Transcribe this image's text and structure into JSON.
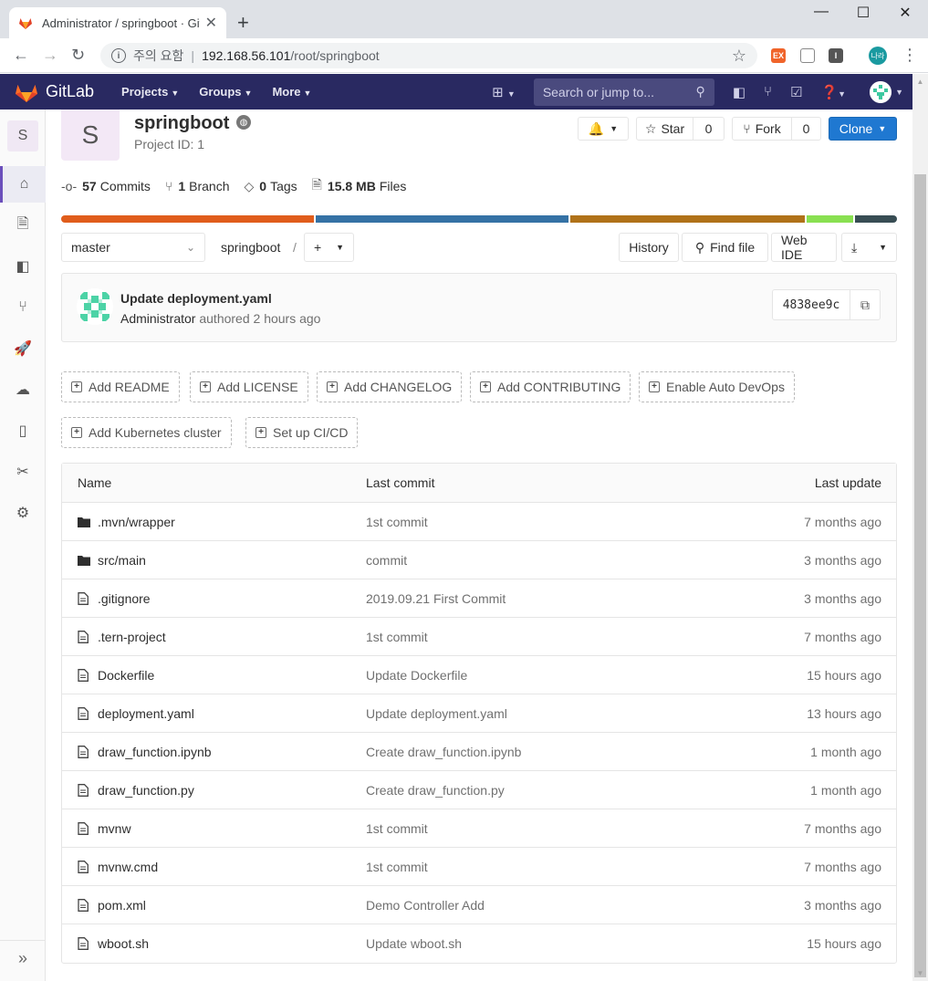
{
  "browser": {
    "tab_title": "Administrator / springboot · GitLab",
    "address_warning": "주의 요함",
    "address_host": "192.168.56.101",
    "address_path": "/root/springboot",
    "profile_label": "나라"
  },
  "nav": {
    "brand": "GitLab",
    "menu": [
      "Projects",
      "Groups",
      "More"
    ],
    "search_placeholder": "Search or jump to..."
  },
  "sidebar": {
    "project_letter": "S"
  },
  "project": {
    "avatar_letter": "S",
    "name": "springboot",
    "id_label": "Project ID: 1",
    "star_label": "Star",
    "star_count": "0",
    "fork_label": "Fork",
    "fork_count": "0",
    "clone_label": "Clone"
  },
  "stats": {
    "commits_count": "57",
    "commits_label": "Commits",
    "branches_count": "1",
    "branches_label": "Branch",
    "tags_count": "0",
    "tags_label": "Tags",
    "files_size": "15.8 MB",
    "files_label": "Files"
  },
  "language_bar": [
    {
      "color": "#e05d1c",
      "share": 30.5
    },
    {
      "color": "#3572a5",
      "share": 30.5
    },
    {
      "color": "#b07219",
      "share": 28.3
    },
    {
      "color": "#89e051",
      "share": 5.6
    },
    {
      "color": "#384d54",
      "share": 5.1
    }
  ],
  "toolbar": {
    "branch": "master",
    "breadcrumb": "springboot",
    "breadcrumb_sep": "/",
    "history": "History",
    "find_file": "Find file",
    "web_ide": "Web IDE"
  },
  "last_commit": {
    "title": "Update deployment.yaml",
    "author": "Administrator",
    "authored": "authored 2 hours ago",
    "sha": "4838ee9c"
  },
  "quick_actions": [
    "Add README",
    "Add LICENSE",
    "Add CHANGELOG",
    "Add CONTRIBUTING",
    "Enable Auto DevOps",
    "Add Kubernetes cluster",
    "Set up CI/CD"
  ],
  "tree": {
    "headers": {
      "name": "Name",
      "commit": "Last commit",
      "update": "Last update"
    },
    "rows": [
      {
        "type": "folder",
        "name": ".mvn/wrapper",
        "commit": "1st commit",
        "date": "7 months ago"
      },
      {
        "type": "folder",
        "name": "src/main",
        "commit": "commit",
        "date": "3 months ago"
      },
      {
        "type": "file",
        "name": ".gitignore",
        "commit": "2019.09.21 First Commit",
        "date": "3 months ago"
      },
      {
        "type": "file",
        "name": ".tern-project",
        "commit": "1st commit",
        "date": "7 months ago"
      },
      {
        "type": "file",
        "name": "Dockerfile",
        "commit": "Update Dockerfile",
        "date": "15 hours ago"
      },
      {
        "type": "file",
        "name": "deployment.yaml",
        "commit": "Update deployment.yaml",
        "date": "13 hours ago"
      },
      {
        "type": "file",
        "name": "draw_function.ipynb",
        "commit": "Create draw_function.ipynb",
        "date": "1 month ago"
      },
      {
        "type": "file",
        "name": "draw_function.py",
        "commit": "Create draw_function.py",
        "date": "1 month ago"
      },
      {
        "type": "file",
        "name": "mvnw",
        "commit": "1st commit",
        "date": "7 months ago"
      },
      {
        "type": "file",
        "name": "mvnw.cmd",
        "commit": "1st commit",
        "date": "7 months ago"
      },
      {
        "type": "file",
        "name": "pom.xml",
        "commit": "Demo Controller Add",
        "date": "3 months ago"
      },
      {
        "type": "file",
        "name": "wboot.sh",
        "commit": "Update wboot.sh",
        "date": "15 hours ago"
      }
    ]
  }
}
